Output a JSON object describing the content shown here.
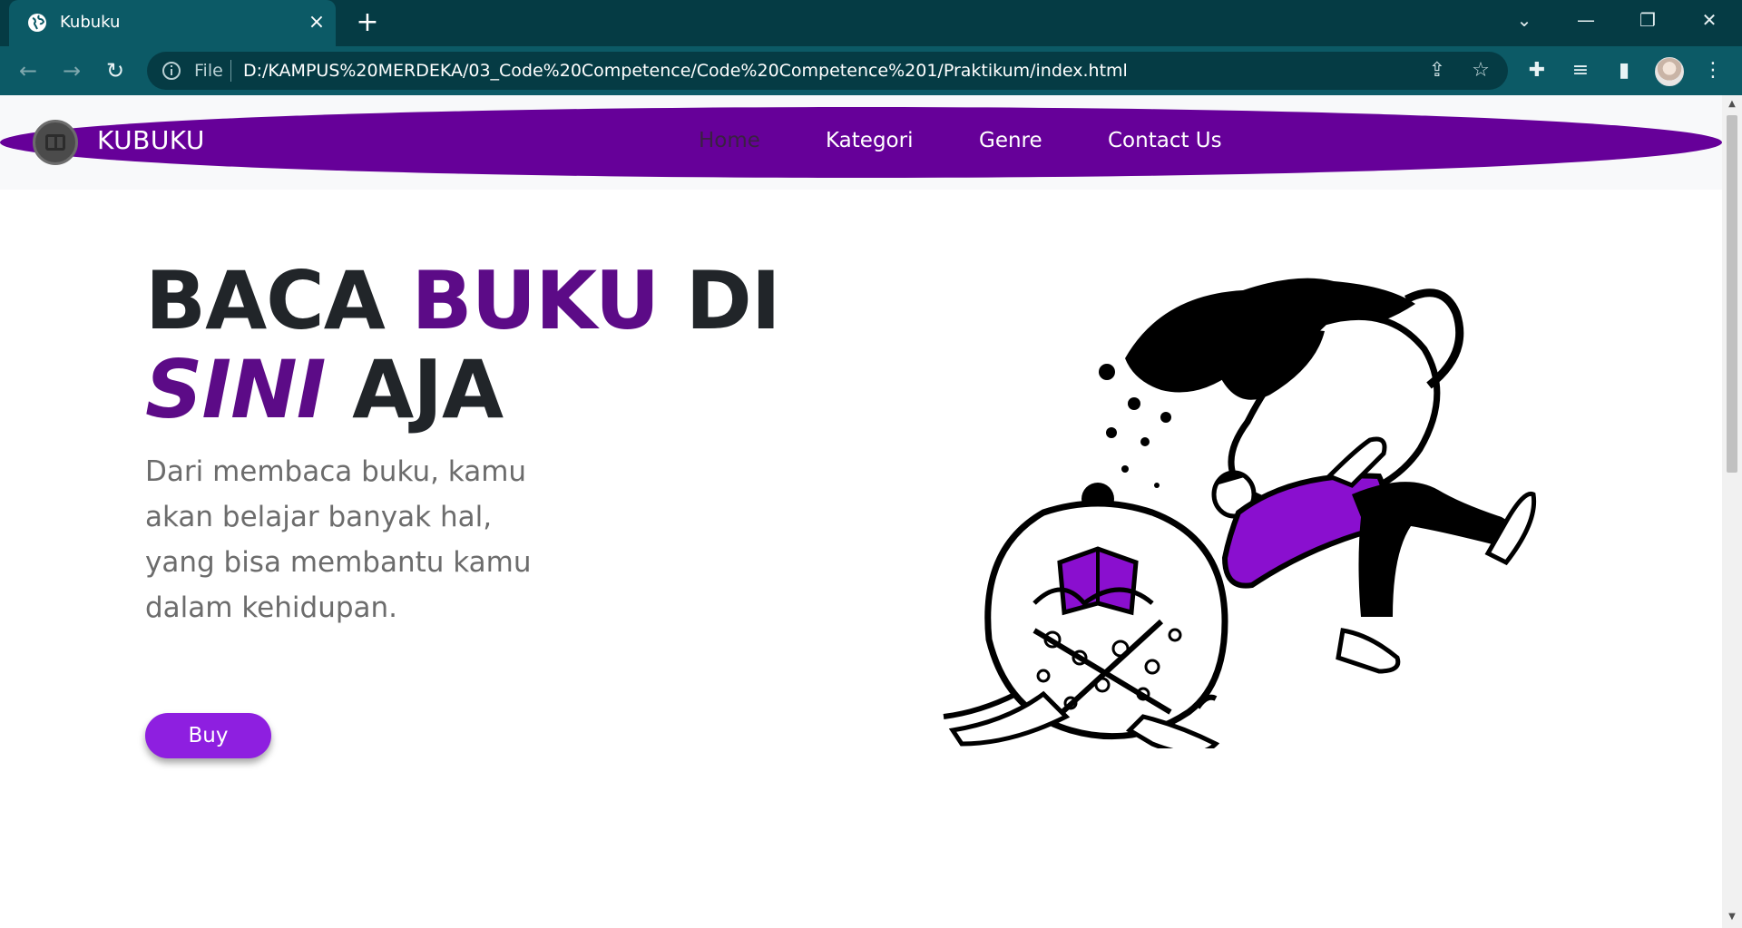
{
  "browser": {
    "tab_title": "Kubuku",
    "new_tab": "+",
    "close_tab": "×",
    "address_scheme": "File",
    "address_url": "D:/KAMPUS%20MERDEKA/03_Code%20Competence/Code%20Competence%201/Praktikum/index.html",
    "icons": [
      "globe-icon",
      "back-icon",
      "forward-icon",
      "reload-icon",
      "info-icon",
      "share-icon",
      "star-icon",
      "extensions-icon",
      "reading-list-icon",
      "sidepanel-icon",
      "profile-avatar",
      "menu-icon",
      "minimize-icon",
      "restore-icon",
      "close-window-icon",
      "tab-search-icon"
    ]
  },
  "navbar": {
    "brand": "KUBUKU",
    "links": [
      {
        "label": "Home",
        "active": true
      },
      {
        "label": "Kategori",
        "active": false
      },
      {
        "label": "Genre",
        "active": false
      },
      {
        "label": "Contact Us",
        "active": false
      }
    ],
    "bg_color": "#660099"
  },
  "hero": {
    "title_part1": "BACA ",
    "title_accent": "BUKU",
    "title_part2": " DI",
    "title_italic": "SINI",
    "title_part3": " AJA",
    "text": "Dari membaca buku, kamu akan belajar banyak hal, yang bisa membantu kamu dalam kehidupan.",
    "button_label": "Buy",
    "accent_color": "#5c0b87",
    "button_color": "#8e1fe0"
  }
}
